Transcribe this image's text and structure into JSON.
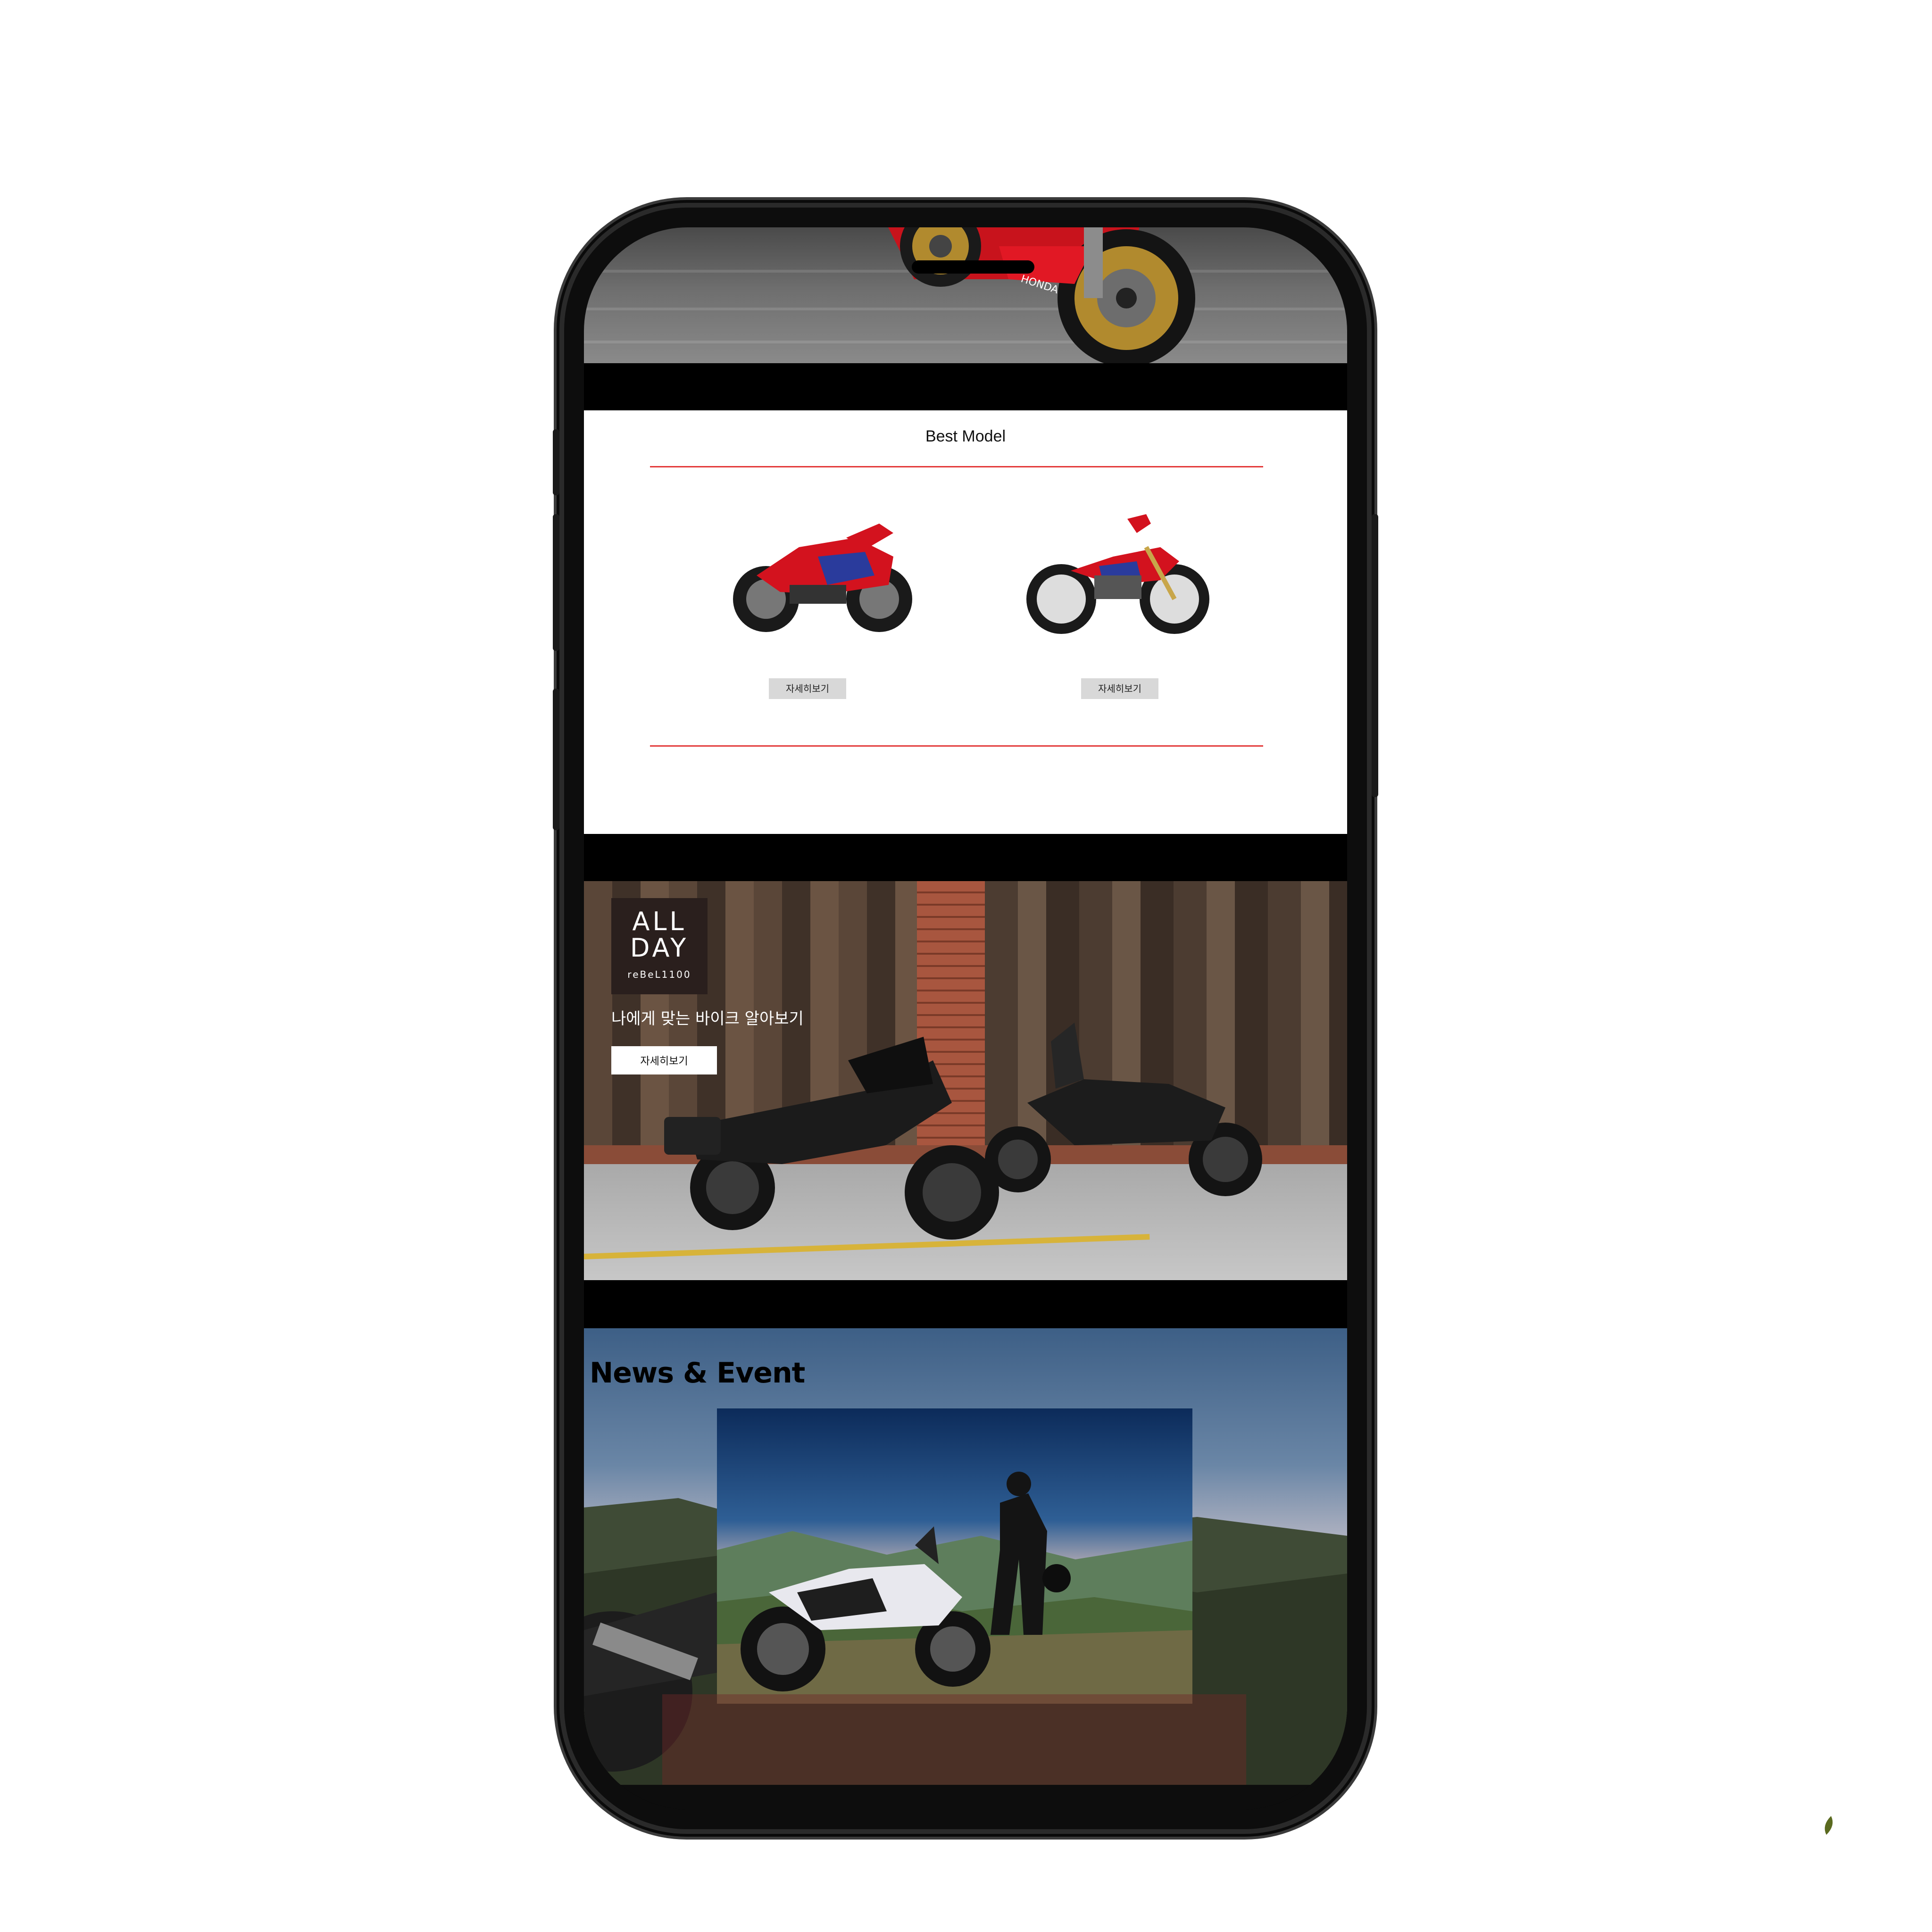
{
  "best_model": {
    "title": "Best Model",
    "models": [
      {
        "detail_label": "자세히보기",
        "colors": {
          "body": "#d3121e",
          "accent": "#2a3b9c"
        }
      },
      {
        "detail_label": "자세히보기",
        "colors": {
          "body": "#d3121e",
          "accent": "#2a3b9c"
        }
      }
    ]
  },
  "rebel_banner": {
    "logo_line1": "ALL",
    "logo_line2": "DAY",
    "logo_line3": "reBeL1100",
    "headline": "나에게 맞는 바이크 알아보기",
    "button_label": "자세히보기"
  },
  "news": {
    "title": "News & Event"
  },
  "colors": {
    "accent_line": "#e33a3a",
    "band": "#000000"
  }
}
